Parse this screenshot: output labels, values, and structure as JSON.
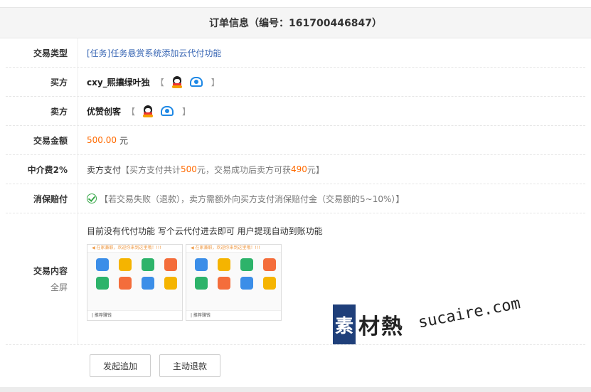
{
  "order": {
    "title": "订单信息（编号：161700446847）"
  },
  "rows": {
    "type": {
      "label": "交易类型",
      "value": "[任务]任务悬赏系统添加云代付功能"
    },
    "buyer": {
      "label": "买方",
      "name": "cxy_熙攘绿叶独",
      "open": "【",
      "close": "】"
    },
    "seller": {
      "label": "卖方",
      "name": "优赞创客",
      "open": "【",
      "close": "】"
    },
    "amount": {
      "label": "交易金额",
      "value": "500.00",
      "unit": "元"
    },
    "fee": {
      "label": "中介费2%",
      "payer": "卖方支付",
      "p1": "【买方支付共计",
      "v1": "500",
      "p2": "元，交易成功后卖方可获",
      "v2": "490",
      "p3": "元】"
    },
    "guarantee": {
      "label": "消保赔付",
      "text": "【若交易失败（退款），卖方需额外向买方支付消保赔付金（交易额的5~10%）】"
    },
    "content": {
      "label": "交易内容",
      "sublabel": "全屏",
      "desc": "目前没有代付功能 写个云代付进去即可  用户提现自动到账功能"
    }
  },
  "thumbs": [
    {
      "banner": "◀ 在家兼职，欢迎你来到这里哦！!!!",
      "footer": "| 推荐赚钱"
    },
    {
      "banner": "◀ 在家兼职，欢迎你来到这里哦！!!!",
      "footer": "| 推荐赚钱"
    }
  ],
  "actions": {
    "append": "发起追加",
    "refund": "主动退款"
  },
  "watermark": {
    "logo": "素",
    "text": "材熱",
    "site": "sucaire.com"
  },
  "colors": {
    "link": "#3b68b5",
    "accent": "#ff6a00",
    "brand": "#1f3f7a"
  }
}
